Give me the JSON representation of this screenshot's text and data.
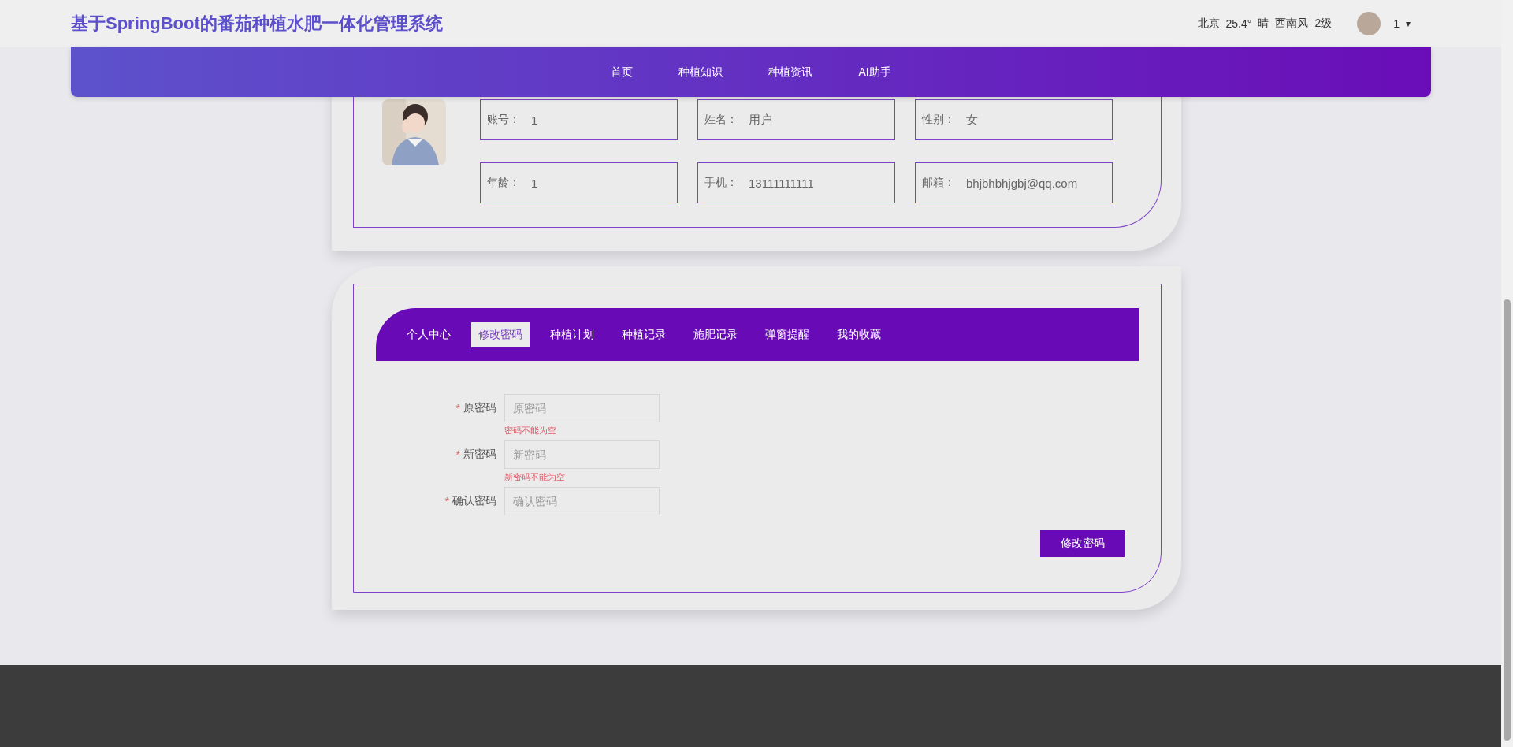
{
  "header": {
    "title": "基于SpringBoot的番茄种植水肥一体化管理系统",
    "weather": [
      "北京",
      "25.4°",
      "晴",
      "西南风",
      "2级"
    ],
    "user": {
      "name": "1",
      "caret": "▾"
    }
  },
  "nav": {
    "items": [
      {
        "label": "首页"
      },
      {
        "label": "种植知识"
      },
      {
        "label": "种植资讯"
      },
      {
        "label": "AI助手"
      }
    ]
  },
  "profile": {
    "fields": [
      {
        "label": "账号：",
        "value": "1"
      },
      {
        "label": "姓名：",
        "value": "用户"
      },
      {
        "label": "性别：",
        "value": "女"
      },
      {
        "label": "年龄：",
        "value": "1"
      },
      {
        "label": "手机：",
        "value": "13111111111"
      },
      {
        "label": "邮箱：",
        "value": "bhjbhbhjgbj@qq.com"
      }
    ]
  },
  "tabs": [
    {
      "label": "个人中心",
      "selected": false
    },
    {
      "label": "修改密码",
      "selected": true
    },
    {
      "label": "种植计划",
      "selected": false
    },
    {
      "label": "种植记录",
      "selected": false
    },
    {
      "label": "施肥记录",
      "selected": false
    },
    {
      "label": "弹窗提醒",
      "selected": false
    },
    {
      "label": "我的收藏",
      "selected": false
    }
  ],
  "form": {
    "required_mark": "*",
    "fields": [
      {
        "label": "原密码",
        "required": true,
        "placeholder": "原密码",
        "error": "密码不能为空"
      },
      {
        "label": "新密码",
        "required": true,
        "placeholder": "新密码",
        "error": "新密码不能为空"
      },
      {
        "label": "确认密码",
        "required": true,
        "placeholder": "确认密码"
      }
    ],
    "submit": "修改密码"
  }
}
